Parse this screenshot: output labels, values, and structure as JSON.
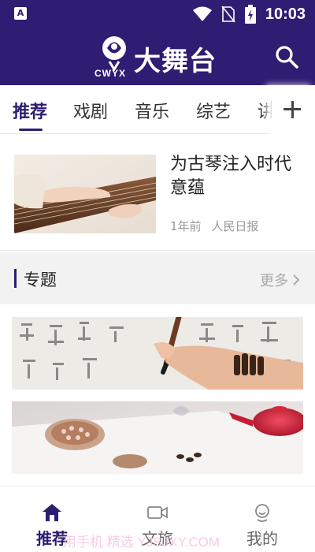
{
  "status_bar": {
    "time": "10:03",
    "icons": [
      "notification-a-icon",
      "wifi-icon",
      "no-sim-icon",
      "battery-charging-icon"
    ]
  },
  "header": {
    "brand_title": "大舞台",
    "brand_subtitle": "CWYX",
    "icons": [
      "logo-icon",
      "search-icon"
    ]
  },
  "tabs": {
    "items": [
      {
        "label": "推荐",
        "active": true
      },
      {
        "label": "戏剧",
        "active": false
      },
      {
        "label": "音乐",
        "active": false
      },
      {
        "label": "综艺",
        "active": false
      },
      {
        "label": "讲",
        "active": false
      }
    ],
    "more_icon": "plus-icon"
  },
  "article": {
    "title": "为古琴注入时代意蕴",
    "time": "1年前",
    "source": "人民日报"
  },
  "section": {
    "title": "专题",
    "more_label": "更多",
    "more_icon": "chevron-right-icon"
  },
  "banners": [
    {
      "image": "calligraphy-image"
    },
    {
      "image": "tea-ceremony-image"
    }
  ],
  "bottom_nav": {
    "items": [
      {
        "label": "推荐",
        "icon": "home-icon",
        "active": true
      },
      {
        "label": "文旅",
        "icon": "video-camera-icon",
        "active": false
      },
      {
        "label": "我的",
        "icon": "user-icon",
        "active": false
      }
    ],
    "watermark": "用手机 精选 YJSJXY.COM"
  },
  "colors": {
    "brand": "#2e1d72",
    "muted_text": "#999999",
    "section_bg": "#f2f2f2"
  }
}
